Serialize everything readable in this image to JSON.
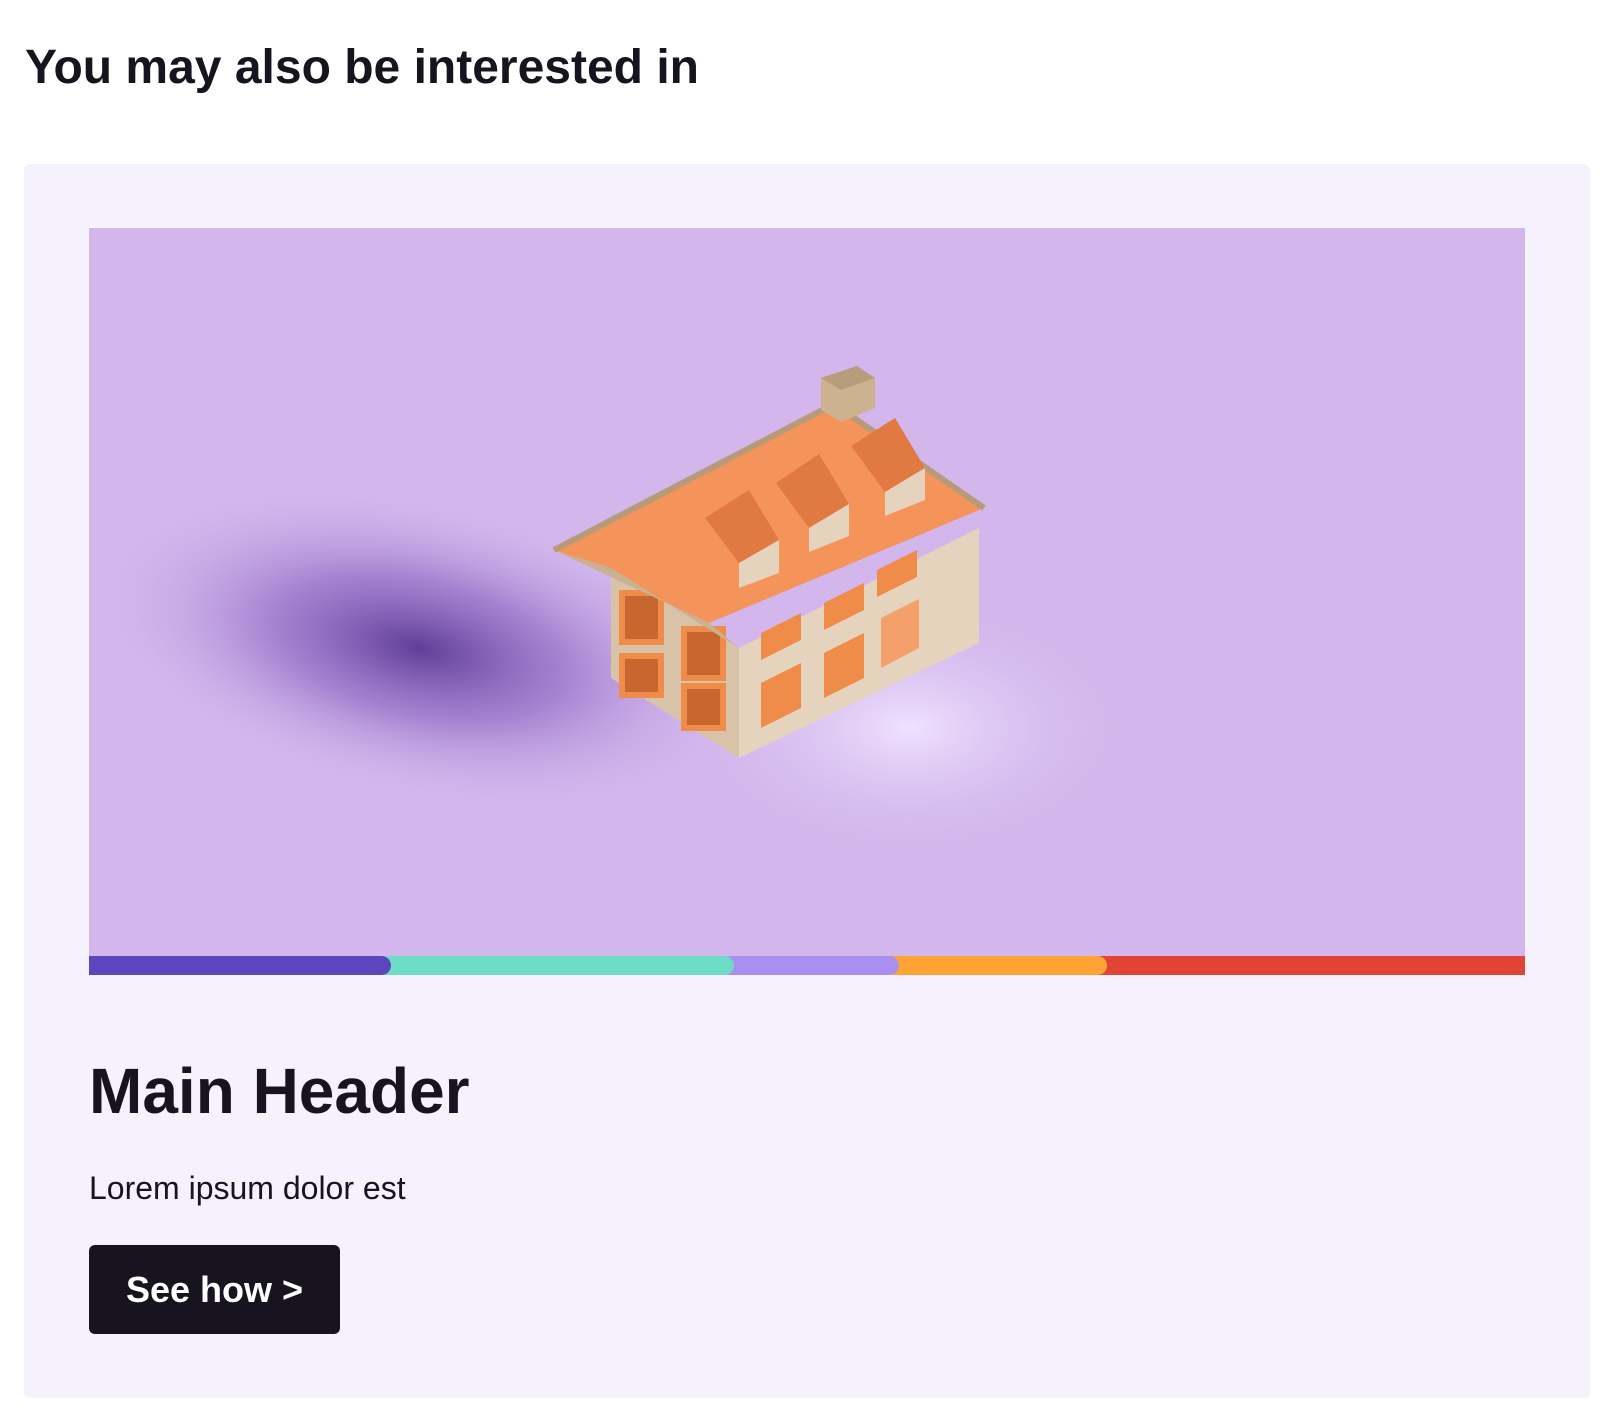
{
  "section": {
    "title": "You may also be interested in"
  },
  "card": {
    "image": {
      "icon": "house-illustration",
      "background_color": "#d2b6ec",
      "roof_color": "#f4935a",
      "wall_color": "#e6d3bd"
    },
    "stripe_colors": [
      "#5b46bd",
      "#6fdcc7",
      "#a98ff0",
      "#ffa334",
      "#e04533"
    ],
    "title": "Main Header",
    "description": "Lorem ipsum dolor est",
    "cta_label": "See how >"
  }
}
